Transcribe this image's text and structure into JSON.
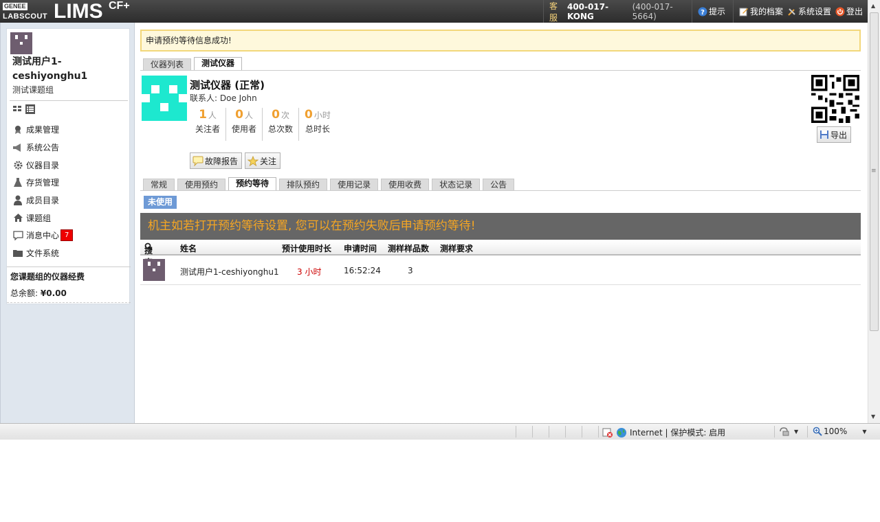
{
  "header": {
    "logo_top": "GENEE",
    "logo_bottom": "LABSCOUT",
    "logo_main": "LIMS",
    "logo_sup": "CF+",
    "hotline_label": "客服",
    "hotline_number": "400-017-KONG",
    "hotline_alt": "(400-017-5664)",
    "tips_label": "提示",
    "profile_label": "我的档案",
    "settings_label": "系统设置",
    "logout_label": "登出"
  },
  "sidebar": {
    "user_name": "测试用户1-ceshiyonghu1",
    "group_name": "测试课题组",
    "nav": [
      {
        "label": "成果管理",
        "icon": "award-icon"
      },
      {
        "label": "系统公告",
        "icon": "megaphone-icon"
      },
      {
        "label": "仪器目录",
        "icon": "gear-icon"
      },
      {
        "label": "存货管理",
        "icon": "flask-icon"
      },
      {
        "label": "成员目录",
        "icon": "person-icon"
      },
      {
        "label": "课题组",
        "icon": "house-icon"
      },
      {
        "label": "消息中心",
        "icon": "message-icon",
        "badge": "7"
      },
      {
        "label": "文件系统",
        "icon": "folder-icon"
      }
    ],
    "fund_title": "您课题组的仪器经费",
    "fund_label": "总余额:",
    "fund_value": "¥0.00"
  },
  "main": {
    "notice": "申请预约等待信息成功!",
    "top_tabs": [
      {
        "label": "仪器列表",
        "active": false
      },
      {
        "label": "测试仪器",
        "active": true
      }
    ],
    "instrument": {
      "title": "测试仪器 (正常)",
      "contact_label": "联系人:",
      "contact_name": "Doe John"
    },
    "stats": [
      {
        "value": "1",
        "unit": "人",
        "label": "关注者"
      },
      {
        "value": "0",
        "unit": "人",
        "label": "使用者"
      },
      {
        "value": "0",
        "unit": "次",
        "label": "总次数"
      },
      {
        "value": "0",
        "unit": "小时",
        "label": "总时长"
      }
    ],
    "buttons": {
      "report": "故障报告",
      "follow": "关注",
      "export": "导出"
    },
    "sub_tabs": [
      {
        "label": "常规",
        "active": false
      },
      {
        "label": "使用预约",
        "active": false
      },
      {
        "label": "预约等待",
        "active": true
      },
      {
        "label": "排队预约",
        "active": false
      },
      {
        "label": "使用记录",
        "active": false
      },
      {
        "label": "使用收费",
        "active": false
      },
      {
        "label": "状态记录",
        "active": false
      },
      {
        "label": "公告",
        "active": false
      }
    ],
    "status_tag": "未使用",
    "banner": "机主如若打开预约等待设置, 您可以在预约失败后申请预约等待!",
    "table": {
      "search_label": "搜索",
      "columns": [
        "姓名",
        "预计使用时长",
        "申请时间",
        "测样样品数",
        "测样要求"
      ],
      "rows": [
        {
          "name": "测试用户1-ceshiyonghu1",
          "duration": "3 小时",
          "time": "16:52:24",
          "samples": "3",
          "requirement": ""
        }
      ]
    }
  },
  "statusbar": {
    "zone": "Internet | 保护模式: 启用",
    "zoom": "100%"
  },
  "colors": {
    "accent_orange": "#f0a030",
    "banner_bg": "#666666",
    "banner_text": "#f5a623",
    "tag_blue": "#6e9ad6",
    "instrument_cyan": "#1de8cf"
  }
}
